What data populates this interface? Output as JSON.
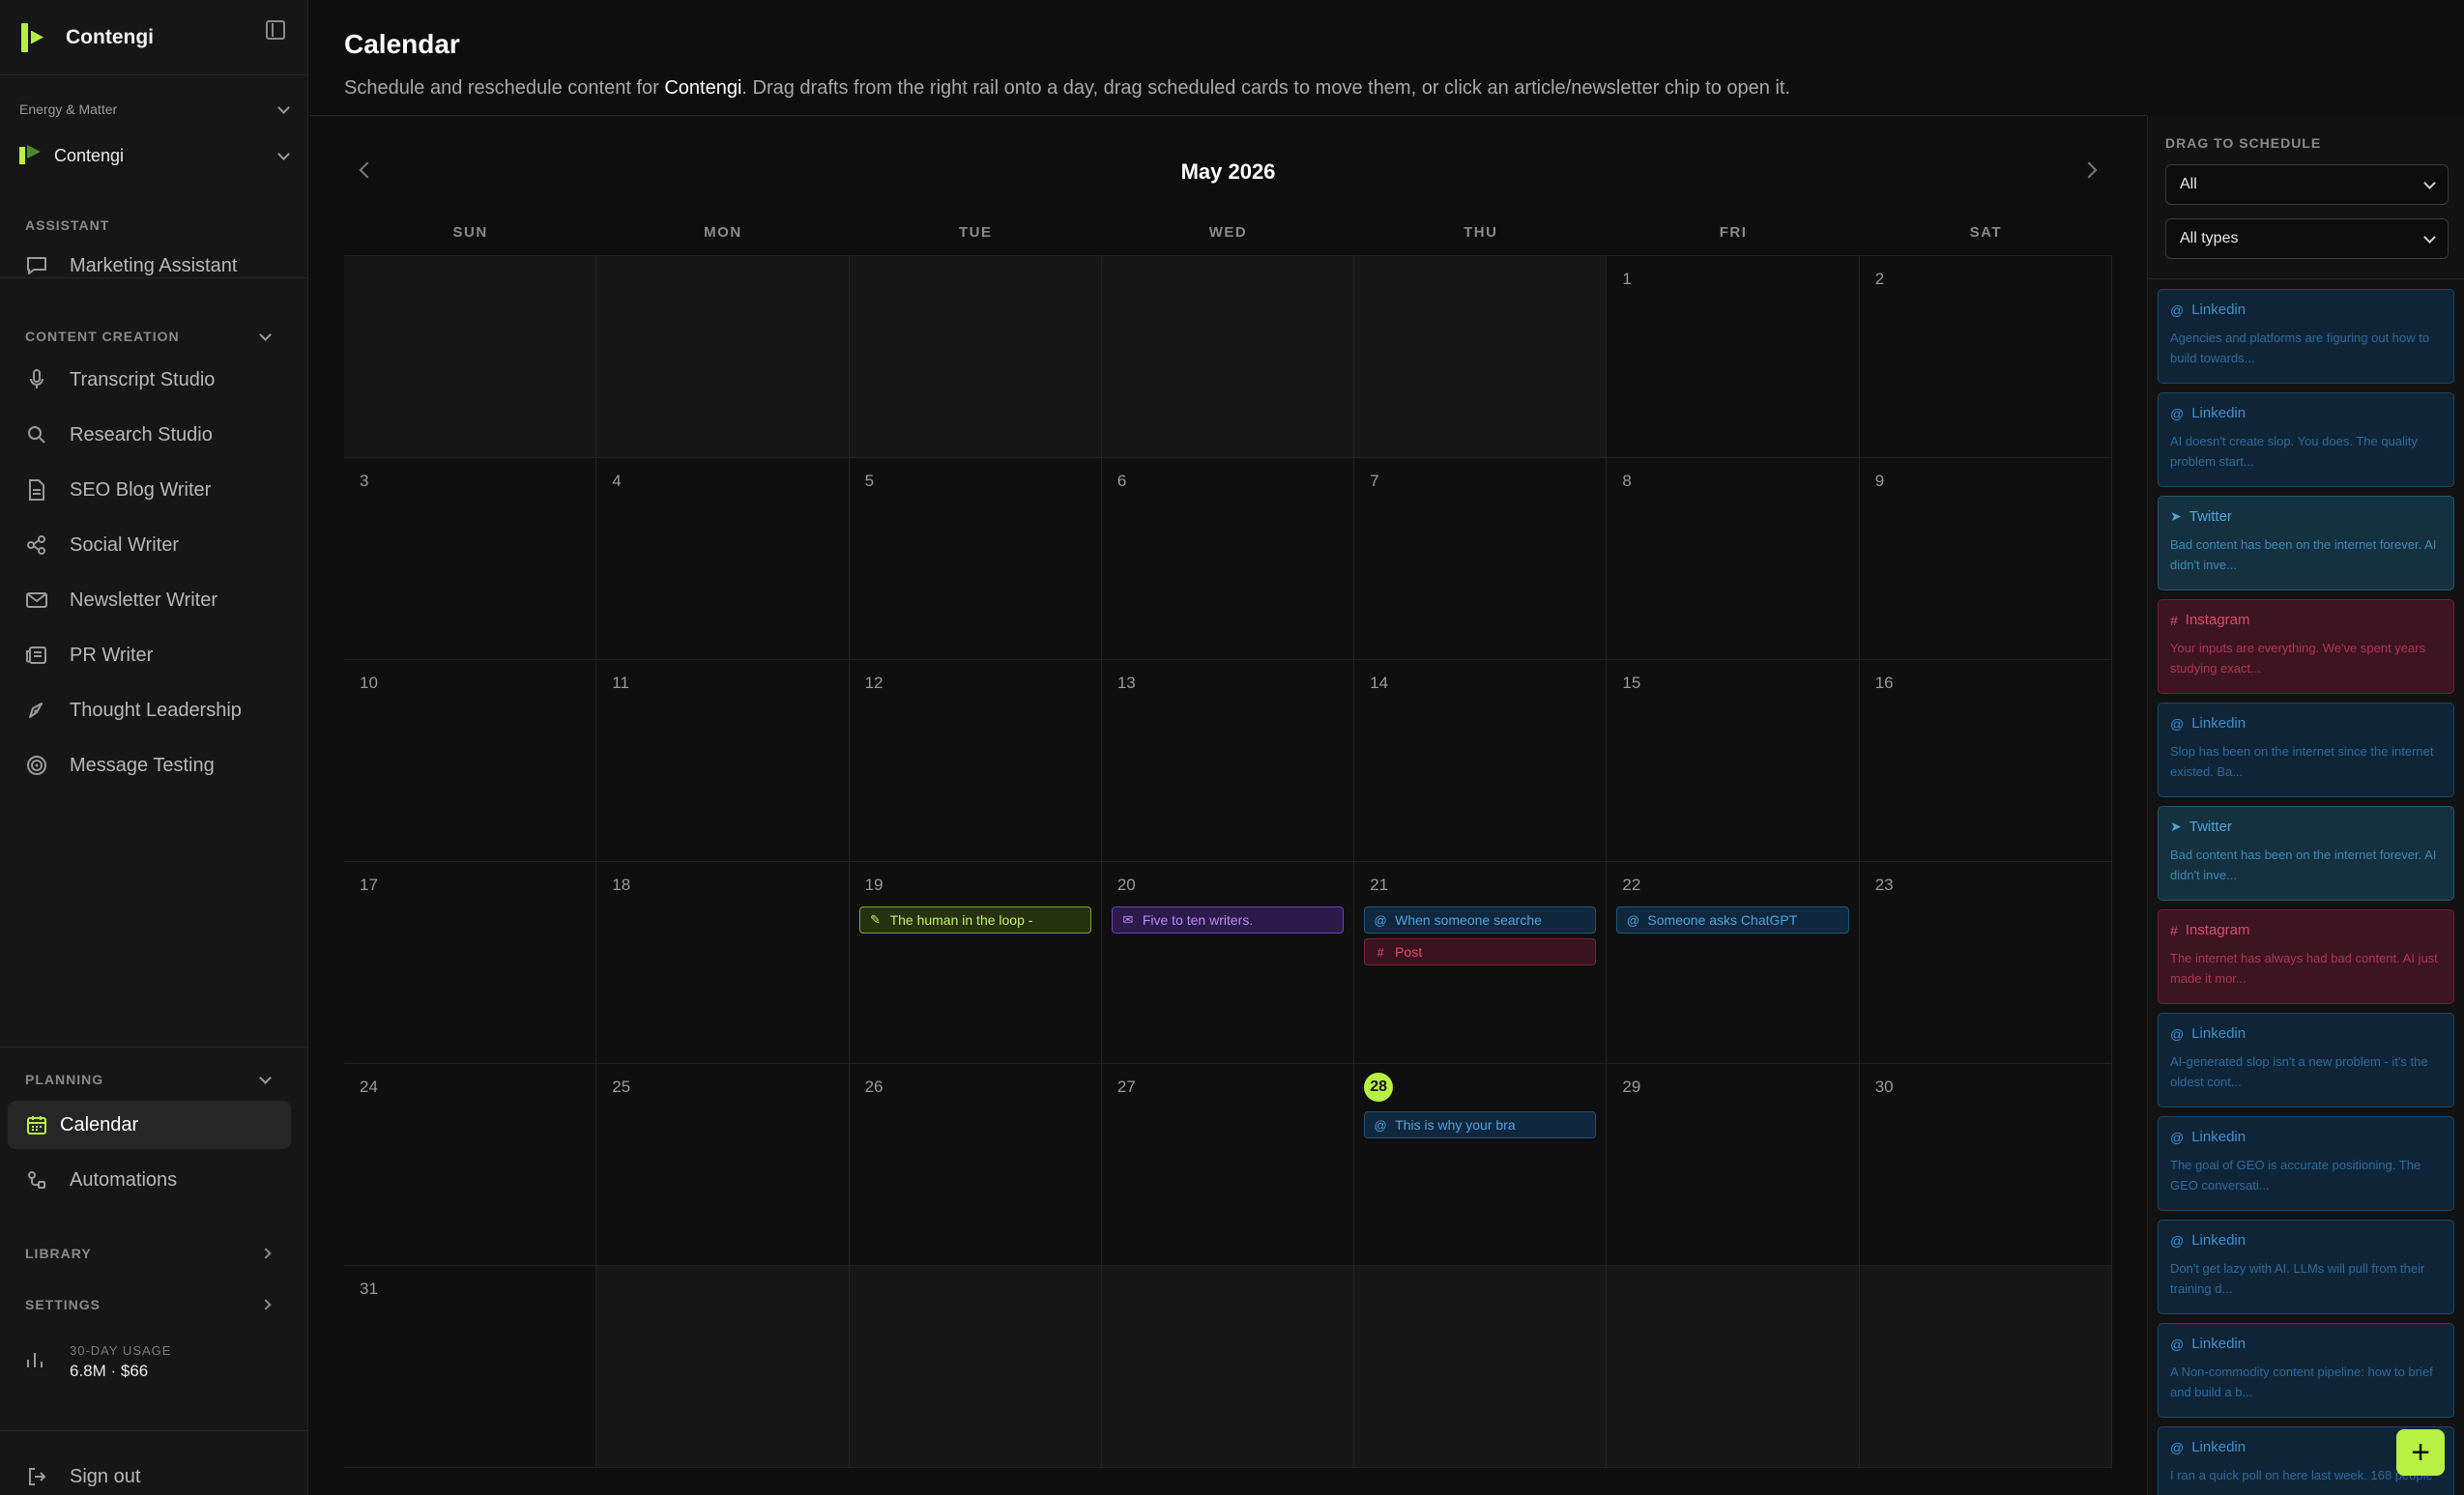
{
  "app": {
    "name": "Contengi"
  },
  "org": {
    "group": "Energy & Matter",
    "brand": "Contengi"
  },
  "sidebar": {
    "assistant_label": "ASSISTANT",
    "assistant_item": "Marketing Assistant",
    "content_label": "CONTENT CREATION",
    "content_items": [
      "Transcript Studio",
      "Research Studio",
      "SEO Blog Writer",
      "Social Writer",
      "Newsletter Writer",
      "PR Writer",
      "Thought Leadership",
      "Message Testing"
    ],
    "planning_label": "PLANNING",
    "planning_items": [
      "Calendar",
      "Automations"
    ],
    "library_label": "LIBRARY",
    "settings_label": "SETTINGS",
    "usage_label": "30-DAY USAGE",
    "usage_value": "6.8M · $66",
    "signout": "Sign out"
  },
  "header": {
    "title": "Calendar",
    "desc_before": "Schedule and reschedule content for ",
    "desc_brand": "Contengi",
    "desc_after": ". Drag drafts from the right rail onto a day, drag scheduled cards to move them, or click an article/newsletter chip to open it."
  },
  "calendar": {
    "month": "May 2026",
    "weekdays": [
      "SUN",
      "MON",
      "TUE",
      "WED",
      "THU",
      "FRI",
      "SAT"
    ],
    "leading_blank": 5,
    "days_in_month": 31,
    "today": 28,
    "events": {
      "19": [
        {
          "type": "tl",
          "icon": "✎",
          "text": "The human in the loop -"
        }
      ],
      "20": [
        {
          "type": "news",
          "icon": "✉",
          "text": "Five to ten writers."
        }
      ],
      "21": [
        {
          "type": "linkedin",
          "icon": "@",
          "text": "When someone searche"
        },
        {
          "type": "insta",
          "icon": "#",
          "text": "Post"
        }
      ],
      "22": [
        {
          "type": "linkedin",
          "icon": "@",
          "text": "Someone asks ChatGPT"
        }
      ],
      "28": [
        {
          "type": "linkedin",
          "icon": "@",
          "text": "This is why your bra"
        }
      ]
    }
  },
  "rail": {
    "title": "DRAG TO SCHEDULE",
    "filter_channel": "All",
    "filter_type": "All types",
    "cards": [
      {
        "kind": "linkedin",
        "icon": "@",
        "platform": "Linkedin",
        "snippet": "Agencies and platforms are figuring out how to build towards..."
      },
      {
        "kind": "linkedin",
        "icon": "@",
        "platform": "Linkedin",
        "snippet": "AI doesn't create slop. You does. The quality problem start..."
      },
      {
        "kind": "twitter",
        "icon": "➤",
        "platform": "Twitter",
        "snippet": "Bad content has been on the internet forever. AI didn't inve..."
      },
      {
        "kind": "instagram",
        "icon": "#",
        "platform": "Instagram",
        "snippet": "Your inputs are everything. We've spent years studying exact..."
      },
      {
        "kind": "linkedin",
        "icon": "@",
        "platform": "Linkedin",
        "snippet": "Slop has been on the internet since the internet existed. Ba..."
      },
      {
        "kind": "twitter",
        "icon": "➤",
        "platform": "Twitter",
        "snippet": "Bad content has been on the internet forever. AI didn't inve..."
      },
      {
        "kind": "instagram",
        "icon": "#",
        "platform": "Instagram",
        "snippet": "The internet has always had bad content. AI just made it mor..."
      },
      {
        "kind": "linkedin",
        "icon": "@",
        "platform": "Linkedin",
        "snippet": "AI-generated slop isn't a new problem - it's the oldest cont..."
      },
      {
        "kind": "linkedin",
        "icon": "@",
        "platform": "Linkedin",
        "snippet": "The goal of GEO is accurate positioning. The GEO conversati..."
      },
      {
        "kind": "linkedin",
        "icon": "@",
        "platform": "Linkedin",
        "snippet": "Don't get lazy with AI. LLMs will pull from their training d..."
      },
      {
        "kind": "linkedin",
        "icon": "@",
        "platform": "Linkedin",
        "snippet": "A Non-commodity content pipeline: how to brief and build a b..."
      },
      {
        "kind": "linkedin",
        "icon": "@",
        "platform": "Linkedin",
        "snippet": "I ran a quick poll on here last week. 168 people"
      }
    ]
  },
  "fab": "+"
}
